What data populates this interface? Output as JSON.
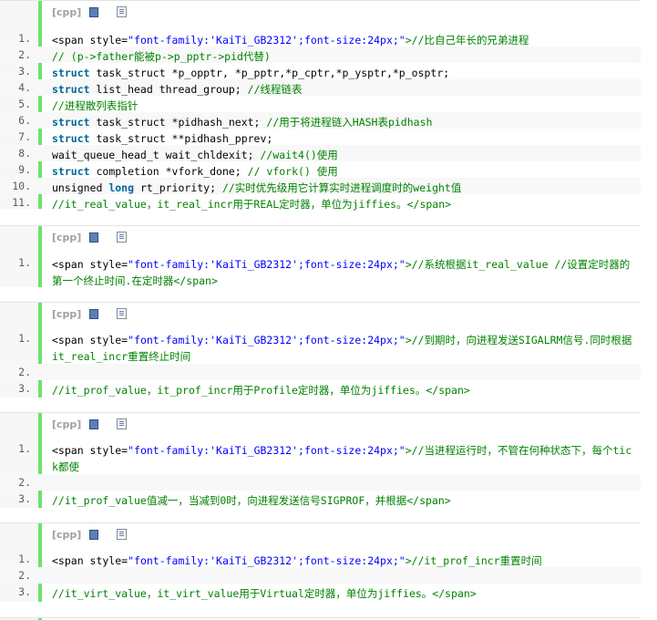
{
  "toolbar": {
    "lang_label": "[cpp]",
    "view_icon": "view-source-icon",
    "copy_icon": "copy-icon"
  },
  "blocks": [
    {
      "lines": [
        {
          "num": "1.",
          "parts": [
            {
              "t": "<span style=",
              "c": "p"
            },
            {
              "t": "\"font-family:'KaiTi_GB2312';font-size:24px;\"",
              "c": "s"
            },
            {
              "t": ">//比自己年长的兄弟进程",
              "c": "c"
            }
          ]
        },
        {
          "num": "2.",
          "parts": [
            {
              "t": "// (p->father能被p->p_pptr->pid代替)",
              "c": "c"
            }
          ]
        },
        {
          "num": "3.",
          "parts": [
            {
              "t": "struct",
              "c": "k"
            },
            {
              "t": " task_struct *p_opptr, *p_pptr,*p_cptr,*p_ysptr,*p_osptr;",
              "c": "p"
            }
          ]
        },
        {
          "num": "4.",
          "parts": [
            {
              "t": "struct",
              "c": "k"
            },
            {
              "t": " list_head thread_group; ",
              "c": "p"
            },
            {
              "t": "//线程链表",
              "c": "c"
            }
          ]
        },
        {
          "num": "5.",
          "parts": [
            {
              "t": "//进程散列表指针",
              "c": "c"
            }
          ]
        },
        {
          "num": "6.",
          "parts": [
            {
              "t": "struct",
              "c": "k"
            },
            {
              "t": " task_struct *pidhash_next; ",
              "c": "p"
            },
            {
              "t": "//用于将进程链入HASH表pidhash",
              "c": "c"
            }
          ]
        },
        {
          "num": "7.",
          "parts": [
            {
              "t": "struct",
              "c": "k"
            },
            {
              "t": " task_struct **pidhash_pprev;",
              "c": "p"
            }
          ]
        },
        {
          "num": "8.",
          "parts": [
            {
              "t": "wait_queue_head_t wait_chldexit; ",
              "c": "p"
            },
            {
              "t": "//wait4()使用",
              "c": "c"
            }
          ]
        },
        {
          "num": "9.",
          "parts": [
            {
              "t": "struct",
              "c": "k"
            },
            {
              "t": " completion *vfork_done; ",
              "c": "p"
            },
            {
              "t": "// vfork() 使用",
              "c": "c"
            }
          ]
        },
        {
          "num": "10.",
          "parts": [
            {
              "t": "unsigned ",
              "c": "p"
            },
            {
              "t": "long",
              "c": "k"
            },
            {
              "t": " rt_priority; ",
              "c": "p"
            },
            {
              "t": "//实时优先级用它计算实时进程调度时的weight值",
              "c": "c"
            }
          ]
        },
        {
          "num": "11.",
          "parts": [
            {
              "t": "//it_real_value，it_real_incr用于REAL定时器，单位为jiffies。</span>",
              "c": "c"
            }
          ]
        }
      ]
    },
    {
      "lines": [
        {
          "num": "1.",
          "parts": [
            {
              "t": "<span style=",
              "c": "p"
            },
            {
              "t": "\"font-family:'KaiTi_GB2312';font-size:24px;\"",
              "c": "s"
            },
            {
              "t": ">//系统根据it_real_value //设置定时器的第一个终止时间.在定时器</span>",
              "c": "c"
            }
          ]
        }
      ]
    },
    {
      "lines": [
        {
          "num": "1.",
          "parts": [
            {
              "t": "<span style=",
              "c": "p"
            },
            {
              "t": "\"font-family:'KaiTi_GB2312';font-size:24px;\"",
              "c": "s"
            },
            {
              "t": ">//到期时，向进程发送SIGALRM信号.同时根据it_real_incr重置终止时间",
              "c": "c"
            }
          ]
        },
        {
          "num": "2.",
          "parts": []
        },
        {
          "num": "3.",
          "parts": [
            {
              "t": "//it_prof_value，it_prof_incr用于Profile定时器，单位为jiffies。</span>",
              "c": "c"
            }
          ]
        }
      ]
    },
    {
      "lines": [
        {
          "num": "1.",
          "parts": [
            {
              "t": "<span style=",
              "c": "p"
            },
            {
              "t": "\"font-family:'KaiTi_GB2312';font-size:24px;\"",
              "c": "s"
            },
            {
              "t": ">//当进程运行时，不管在何种状态下，每个tick都使",
              "c": "c"
            }
          ]
        },
        {
          "num": "2.",
          "parts": []
        },
        {
          "num": "3.",
          "parts": [
            {
              "t": "//it_prof_value值减一，当减到0时，向进程发送信号SIGPROF，并根据</span>",
              "c": "c"
            }
          ]
        }
      ]
    },
    {
      "lines": [
        {
          "num": "1.",
          "parts": [
            {
              "t": "<span style=",
              "c": "p"
            },
            {
              "t": "\"font-family:'KaiTi_GB2312';font-size:24px;\"",
              "c": "s"
            },
            {
              "t": ">//it_prof_incr重置时间",
              "c": "c"
            }
          ]
        },
        {
          "num": "2.",
          "parts": []
        },
        {
          "num": "3.",
          "parts": [
            {
              "t": "//it_virt_value，it_virt_value用于Virtual定时器，单位为jiffies。</span>",
              "c": "c"
            }
          ]
        }
      ]
    }
  ]
}
